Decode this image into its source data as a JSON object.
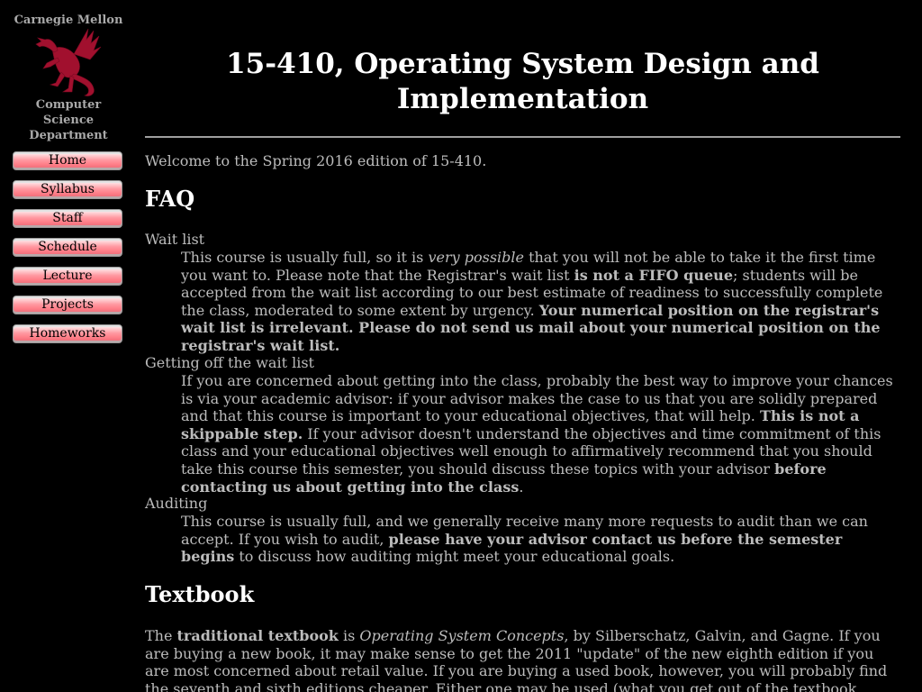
{
  "sidebar": {
    "university": "Carnegie Mellon",
    "department_lines": [
      "Computer",
      "Science",
      "Department"
    ],
    "nav": [
      {
        "label": "Home"
      },
      {
        "label": "Syllabus"
      },
      {
        "label": "Staff"
      },
      {
        "label": "Schedule"
      },
      {
        "label": "Lecture"
      },
      {
        "label": "Projects"
      },
      {
        "label": "Homeworks"
      }
    ]
  },
  "header": {
    "title_line1": "15-410, Operating System Design and",
    "title_line2": "Implementation"
  },
  "intro": "Welcome to the Spring 2016 edition of 15-410.",
  "faq": {
    "heading": "FAQ",
    "items": [
      {
        "term": "Wait list",
        "parts": [
          {
            "text": "This course is usually full, so it is "
          },
          {
            "text": "very possible",
            "style": "i"
          },
          {
            "text": " that you will not be able to take it the first time you want to. Please note that the Registrar's wait list "
          },
          {
            "text": "is not a FIFO queue",
            "style": "b"
          },
          {
            "text": "; students will be accepted from the wait list according to our best estimate of readiness to successfully complete the class, moderated to some extent by urgency. "
          },
          {
            "text": "Your numerical position on the registrar's wait list is irrelevant. Please do not send us mail about your numerical position on the registrar's wait list.",
            "style": "b"
          }
        ]
      },
      {
        "term": "Getting off the wait list",
        "parts": [
          {
            "text": "If you are concerned about getting into the class, probably the best way to improve your chances is via your academic advisor: if your advisor makes the case to us that you are solidly prepared and that this course is important to your educational objectives, that will help. "
          },
          {
            "text": "This is not a skippable step.",
            "style": "b"
          },
          {
            "text": " If your advisor doesn't understand the objectives and time commitment of this class and your educational objectives well enough to affirmatively recommend that you should take this course this semester, you should discuss these topics with your advisor "
          },
          {
            "text": "before contacting us about getting into the class",
            "style": "b"
          },
          {
            "text": "."
          }
        ]
      },
      {
        "term": "Auditing",
        "parts": [
          {
            "text": "This course is usually full, and we generally receive many more requests to audit than we can accept. If you wish to audit, "
          },
          {
            "text": "please have your advisor contact us before the semester begins",
            "style": "b"
          },
          {
            "text": " to discuss how auditing might meet your educational goals."
          }
        ]
      }
    ]
  },
  "textbook": {
    "heading": "Textbook",
    "parts": [
      {
        "text": "The "
      },
      {
        "text": "traditional textbook",
        "style": "b"
      },
      {
        "text": " is "
      },
      {
        "text": "Operating System Concepts",
        "style": "i"
      },
      {
        "text": ", by Silberschatz, Galvin, and Gagne. If you are buying a new book, it may make sense to get the 2011 \"update\" of the new eighth edition if you are most concerned about retail value. If you are buying a used book, however, you will probably find the seventh and sixth editions cheaper. Either one may be used (what you get out of the textbook depends"
      }
    ]
  },
  "colors": {
    "background": "#000000",
    "body_text": "#bcbcbc",
    "heading_text": "#ffffff",
    "nav_button": "#ff8f98",
    "logo": "#a1102e"
  },
  "icons": {
    "logo": "dragon-logo-icon"
  }
}
